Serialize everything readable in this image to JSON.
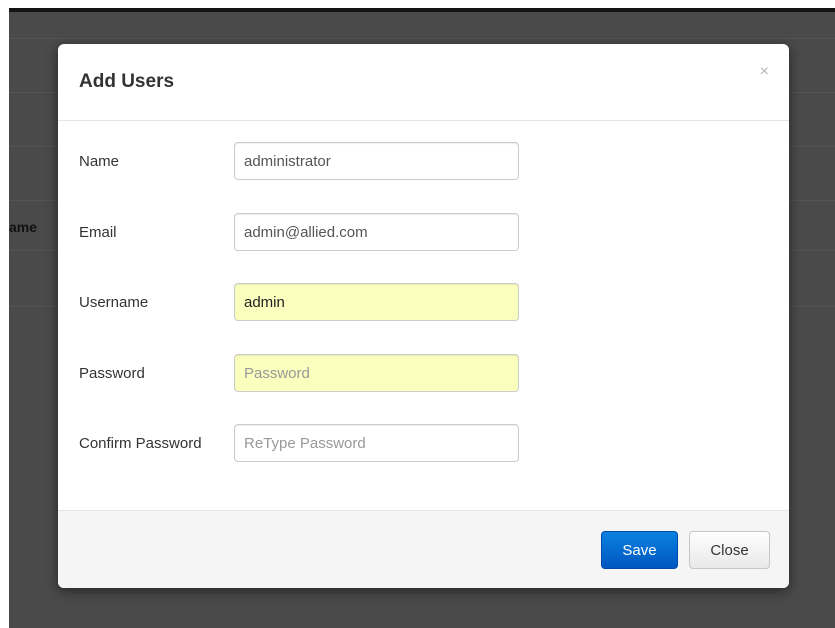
{
  "background": {
    "partial_column_header": "ame"
  },
  "modal": {
    "title": "Add Users",
    "close_glyph": "×",
    "fields": [
      {
        "label": "Name",
        "value": "administrator",
        "placeholder": ""
      },
      {
        "label": "Email",
        "value": "admin@allied.com",
        "placeholder": ""
      },
      {
        "label": "Username",
        "value": "admin",
        "placeholder": ""
      },
      {
        "label": "Password",
        "value": "",
        "placeholder": "Password"
      },
      {
        "label": "Confirm Password",
        "value": "",
        "placeholder": "ReType Password"
      }
    ],
    "save_label": "Save",
    "close_label": "Close"
  },
  "colors": {
    "primary_button": "#0066cc",
    "autofill_background": "#faffbd",
    "overlay": "#4a4a4a"
  },
  "icons": {
    "close": "close-icon"
  }
}
